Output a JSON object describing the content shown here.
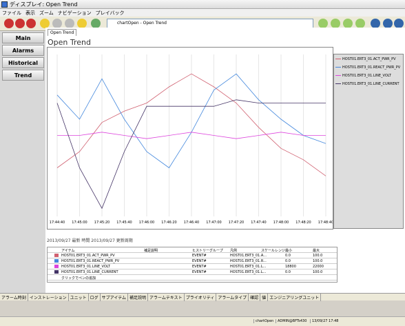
{
  "window": {
    "title": "ディスプレイ: Open Trend"
  },
  "menu": [
    "ファイル",
    "表示",
    "ズーム",
    "ナビゲーション",
    "プレイバック"
  ],
  "toolbar": {
    "address": "chartOpen - Open Trend"
  },
  "nav": [
    "Main",
    "Alarms",
    "Historical",
    "Trend"
  ],
  "page": {
    "tab": "Open Trend",
    "title": "Open Trend"
  },
  "chart_data": {
    "type": "line",
    "x": [
      "17:44:40",
      "17:45:00",
      "17:45:20",
      "17:45:40",
      "17:46:00",
      "17:46:20",
      "17:46:40",
      "17:47:00",
      "17:47:20",
      "17:47:40",
      "17:48:00",
      "17:48:20",
      "17:48:40"
    ],
    "series": [
      {
        "name": "HOST01.ERT3_01.ACT_PWR_PV",
        "color": "#d06070",
        "values": [
          30,
          40,
          58,
          65,
          70,
          80,
          88,
          80,
          70,
          55,
          42,
          35,
          25
        ]
      },
      {
        "name": "HOST01.ERT3_01.REACT_PWR_PV",
        "color": "#4488dd",
        "values": [
          75,
          60,
          85,
          60,
          40,
          30,
          52,
          78,
          88,
          72,
          60,
          50,
          45
        ]
      },
      {
        "name": "HOST01.ERT3_01.LINE_VOLT",
        "color": "#dd44dd",
        "values": [
          50,
          50,
          52,
          50,
          48,
          50,
          52,
          50,
          48,
          50,
          52,
          50,
          50
        ]
      },
      {
        "name": "HOST01.ERT3_01.LINE_CURRENT",
        "color": "#443366",
        "values": [
          70,
          30,
          5,
          40,
          68,
          68,
          68,
          68,
          72,
          70,
          70,
          70,
          70
        ]
      }
    ]
  },
  "controls": {
    "text": "2013/09/27 最新 時間 2013/09/27 更新周期"
  },
  "grid": {
    "headers": [
      "アイテム",
      "補足説明",
      "ヒストリーグループ",
      "凡例",
      "スケールレンジ",
      "最小",
      "最大"
    ],
    "rows": [
      [
        "HOST01.ERT3_01.ACT_PWR_PV",
        "EVENT#",
        "HOST01.ERT3_01.A...",
        "0.0",
        "100.0"
      ],
      [
        "HOST01.ERT3_01.REACT_PWR_PV",
        "EVENT#",
        "HOST01.ERT3_01.R...",
        "0.0",
        "100.0"
      ],
      [
        "HOST01.ERT3_01.LINE_VOLT",
        "EVENT#",
        "HOST01.ERT3_01.L...",
        "18800",
        "22000"
      ],
      [
        "HOST01.ERT3_01.LINE_CURRENT",
        "EVENT#",
        "HOST01.ERT3_01.L...",
        "0.0",
        "100.0"
      ]
    ],
    "add": "クリックでペンの追加"
  },
  "bottomtabs": [
    "アラーム時刻",
    "インストレーション",
    "ユニット",
    "ログ",
    "サブアイテム",
    "補足説明",
    "アラームテキスト",
    "プライオリティ",
    "アラームタイプ",
    "確認",
    "値",
    "エンジニアリングユニット"
  ],
  "status": [
    "chartOpen",
    "ADMIN@BFTs430",
    "13/09/27 17:48"
  ]
}
